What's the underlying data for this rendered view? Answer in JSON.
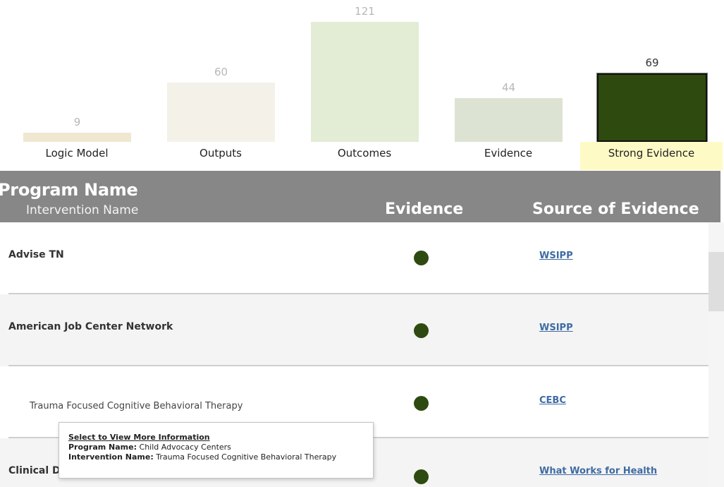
{
  "chart_data": {
    "type": "bar",
    "categories": [
      "Logic Model",
      "Outputs",
      "Outcomes",
      "Evidence",
      "Strong Evidence"
    ],
    "values": [
      9,
      60,
      121,
      44,
      69
    ],
    "colors": [
      "#efe7d0",
      "#f3f1e8",
      "#e3ecd5",
      "#dde3d3",
      "#2e4a0e"
    ],
    "selected": "Strong Evidence",
    "title": "",
    "xlabel": "",
    "ylabel": ""
  },
  "table": {
    "headers": {
      "program": "Program Name",
      "intervention": "Intervention Name",
      "evidence": "Evidence",
      "source": "Source of Evidence"
    },
    "rows": [
      {
        "name": "Advise TN",
        "intervention": "",
        "source": "WSIPP"
      },
      {
        "name": "American Job Center Network",
        "intervention": "",
        "source": "WSIPP"
      },
      {
        "name": "",
        "intervention": "Trauma Focused Cognitive Behavioral Therapy",
        "source": "CEBC"
      },
      {
        "name": "Clinical D",
        "intervention": "",
        "source": "What Works for Health"
      }
    ],
    "evidence_dot_color": "#2f4a10"
  },
  "tooltip": {
    "title": "Select to View More Information",
    "program_key": "Program Name:",
    "program_value": "Child Advocacy Centers",
    "intervention_key": "Intervention Name:",
    "intervention_value": "Trauma Focused Cognitive Behavioral Therapy"
  }
}
